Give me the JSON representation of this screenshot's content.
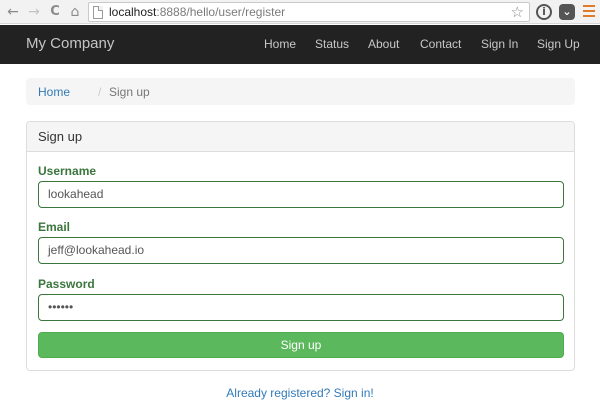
{
  "browser": {
    "url_host": "localhost",
    "url_path": ":8888/hello/user/register",
    "back_glyph": "←",
    "forward_glyph": "→",
    "reload_glyph": "C",
    "home_glyph": "⌂",
    "star_glyph": "☆",
    "info_glyph": "i",
    "pocket_glyph": "⌄"
  },
  "navbar": {
    "brand": "My Company",
    "links": [
      "Home",
      "Status",
      "About",
      "Contact",
      "Sign In",
      "Sign Up"
    ]
  },
  "breadcrumb": {
    "home": "Home",
    "separator": "/",
    "current": "Sign up"
  },
  "form": {
    "title": "Sign up",
    "username_label": "Username",
    "username_value": "lookahead",
    "email_label": "Email",
    "email_value": "jeff@lookahead.io",
    "password_label": "Password",
    "password_value": "••••••",
    "submit_label": "Sign up"
  },
  "footer": {
    "signin_link": "Already registered? Sign in!"
  },
  "colors": {
    "navbar_bg": "#222222",
    "success_green": "#3c763d",
    "button_green": "#5cb85c",
    "link_blue": "#337ab7"
  }
}
